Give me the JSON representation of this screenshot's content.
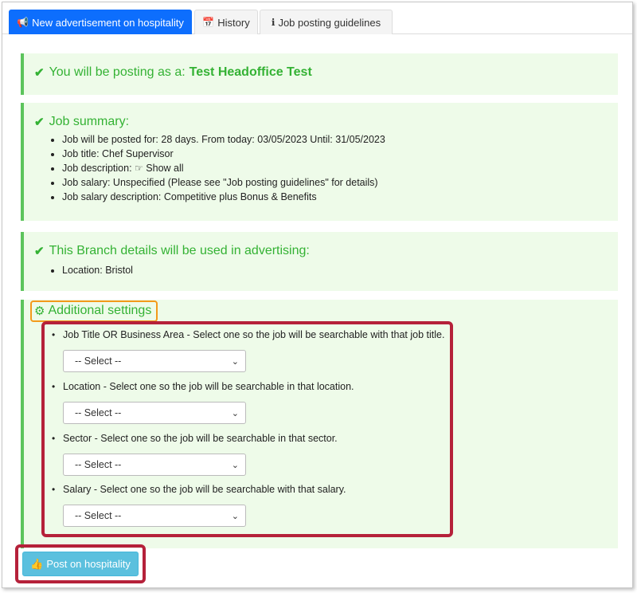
{
  "tabs": [
    {
      "icon": "megaphone-icon",
      "glyph": "📢",
      "label": "New advertisement on hospitality",
      "active": true
    },
    {
      "icon": "calendar-icon",
      "glyph": "📅",
      "label": "History",
      "active": false
    },
    {
      "icon": "info-circle-icon",
      "glyph": "ℹ",
      "label": "Job posting guidelines",
      "active": false
    }
  ],
  "posting_as": {
    "prefix": "You will be posting as a:",
    "name": "Test Headoffice Test"
  },
  "job_summary": {
    "title": "Job summary:",
    "items": [
      "Job will be posted for: 28 days. From today: 03/05/2023 Until: 31/05/2023",
      "Job title: Chef Supervisor",
      "Job description:",
      "Job salary: Unspecified (Please see \"Job posting guidelines\" for details)",
      "Job salary description: Competitive plus Bonus & Benefits"
    ],
    "show_all": "Show all"
  },
  "branch": {
    "title": "This Branch details will be used in advertising:",
    "items": [
      "Location: Bristol"
    ]
  },
  "additional_settings": {
    "title": "Additional settings",
    "fields": [
      {
        "label": "Job Title OR Business Area - Select one so the job will be searchable with that job title.",
        "value": "-- Select --"
      },
      {
        "label": "Location - Select one so the job will be searchable in that location.",
        "value": "-- Select --"
      },
      {
        "label": "Sector - Select one so the job will be searchable in that sector.",
        "value": "-- Select --"
      },
      {
        "label": "Salary - Select one so the job will be searchable with that salary.",
        "value": "-- Select --"
      }
    ]
  },
  "post_button": {
    "label": "Post on hospitality",
    "icon": "thumbs-up-icon"
  },
  "colors": {
    "active_tab": "#0d6efd",
    "panel_bg": "#eefbe9",
    "success_green": "#34b234",
    "button_info": "#5bc0de",
    "highlight_red": "#b5213a",
    "highlight_orange": "#f39a1b"
  }
}
